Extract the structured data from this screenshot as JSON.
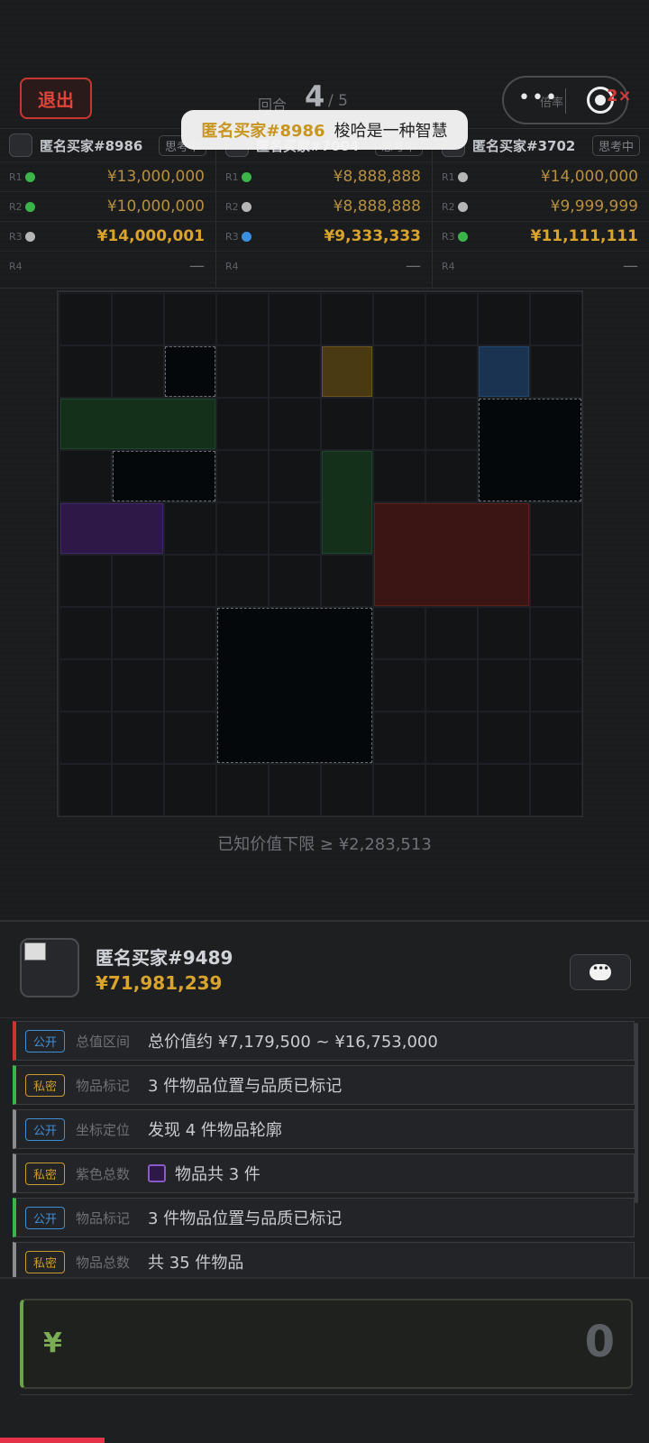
{
  "header": {
    "exit_label": "退出",
    "round_label": "回合",
    "round_current": "4",
    "round_total": "/ 5",
    "capsule_dots": "•••",
    "rate_label": "倍率",
    "multiplier": "2×"
  },
  "toast": {
    "who": "匿名买家#8986",
    "msg": "梭哈是一种智慧"
  },
  "bidders": [
    {
      "name": "匿名买家#8986",
      "status": "思考中",
      "rows": [
        {
          "r": "R1",
          "dot": "green",
          "amount": "¥13,000,000",
          "highlight": false
        },
        {
          "r": "R2",
          "dot": "green",
          "amount": "¥10,000,000",
          "highlight": false
        },
        {
          "r": "R3",
          "dot": "grey",
          "amount": "¥14,000,001",
          "highlight": true
        },
        {
          "r": "R4",
          "dot": "none",
          "amount": "—",
          "highlight": false
        }
      ]
    },
    {
      "name": "匿名买家#7004",
      "status": "思考中",
      "rows": [
        {
          "r": "R1",
          "dot": "green",
          "amount": "¥8,888,888",
          "highlight": false
        },
        {
          "r": "R2",
          "dot": "grey",
          "amount": "¥8,888,888",
          "highlight": false
        },
        {
          "r": "R3",
          "dot": "blue",
          "amount": "¥9,333,333",
          "highlight": true
        },
        {
          "r": "R4",
          "dot": "none",
          "amount": "—",
          "highlight": false
        }
      ]
    },
    {
      "name": "匿名买家#3702",
      "status": "思考中",
      "rows": [
        {
          "r": "R1",
          "dot": "grey",
          "amount": "¥14,000,000",
          "highlight": false
        },
        {
          "r": "R2",
          "dot": "grey",
          "amount": "¥9,999,999",
          "highlight": false
        },
        {
          "r": "R3",
          "dot": "green",
          "amount": "¥11,111,111",
          "highlight": true
        },
        {
          "r": "R4",
          "dot": "none",
          "amount": "—",
          "highlight": false
        }
      ]
    }
  ],
  "warehouse": {
    "cols": 10,
    "rows": 10,
    "items": [
      {
        "kind": "unknown",
        "col": 2,
        "row": 1,
        "w": 1,
        "h": 1
      },
      {
        "kind": "yellow",
        "col": 5,
        "row": 1,
        "w": 1,
        "h": 1
      },
      {
        "kind": "blue",
        "col": 8,
        "row": 1,
        "w": 1,
        "h": 1
      },
      {
        "kind": "green",
        "col": 0,
        "row": 2,
        "w": 3,
        "h": 1
      },
      {
        "kind": "unknown",
        "col": 8,
        "row": 2,
        "w": 2,
        "h": 2
      },
      {
        "kind": "unknown",
        "col": 1,
        "row": 3,
        "w": 2,
        "h": 1
      },
      {
        "kind": "green",
        "col": 5,
        "row": 3,
        "w": 1,
        "h": 2
      },
      {
        "kind": "purple",
        "col": 0,
        "row": 4,
        "w": 2,
        "h": 1
      },
      {
        "kind": "red",
        "col": 6,
        "row": 4,
        "w": 3,
        "h": 2
      },
      {
        "kind": "unknown",
        "col": 3,
        "row": 6,
        "w": 3,
        "h": 3
      }
    ],
    "lower_bound": "已知价值下限 ≥ ¥2,283,513"
  },
  "me": {
    "name": "匿名买家#9489",
    "money": "¥71,981,239"
  },
  "clues": [
    {
      "accent": "red",
      "tag": "公开",
      "tag_kind": "pub",
      "type": "总值区间",
      "text": "总价值约 ¥7,179,500 ~ ¥16,753,000",
      "purple": false
    },
    {
      "accent": "green",
      "tag": "私密",
      "tag_kind": "pri",
      "type": "物品标记",
      "text": "3 件物品位置与品质已标记",
      "purple": false
    },
    {
      "accent": "grey",
      "tag": "公开",
      "tag_kind": "pub",
      "type": "坐标定位",
      "text": "发现 4 件物品轮廓",
      "purple": false
    },
    {
      "accent": "grey",
      "tag": "私密",
      "tag_kind": "pri",
      "type": "紫色总数",
      "text": "物品共 3 件",
      "purple": true
    },
    {
      "accent": "green",
      "tag": "公开",
      "tag_kind": "pub",
      "type": "物品标记",
      "text": "3 件物品位置与品质已标记",
      "purple": false
    },
    {
      "accent": "grey",
      "tag": "私密",
      "tag_kind": "pri",
      "type": "物品总数",
      "text": "共 35 件物品",
      "purple": false
    }
  ],
  "bid_input": {
    "currency": "¥",
    "value": "0"
  },
  "colors": {
    "gold": "#d9a32c",
    "exit_red": "#c8372f",
    "input_green": "#6ca24a"
  }
}
